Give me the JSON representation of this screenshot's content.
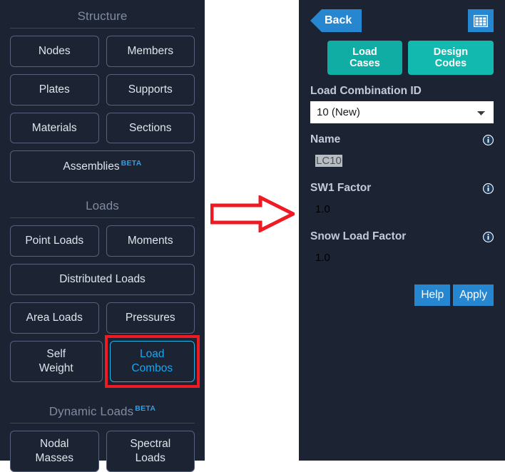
{
  "colors": {
    "panel_bg": "#1c2433",
    "accent_blue": "#2786d0",
    "accent_teal": "#0fada4",
    "active_cyan": "#16a7f0",
    "annotation_red": "#ee1b24",
    "beta_blue": "#2f9fe8"
  },
  "sidebar": {
    "sections": [
      {
        "title": "Structure",
        "rows": [
          [
            {
              "label": "Nodes"
            },
            {
              "label": "Members"
            }
          ],
          [
            {
              "label": "Plates"
            },
            {
              "label": "Supports"
            }
          ],
          [
            {
              "label": "Materials"
            },
            {
              "label": "Sections"
            }
          ],
          [
            {
              "label": "Assemblies",
              "badge": "BETA",
              "full": true
            }
          ]
        ]
      },
      {
        "title": "Loads",
        "rows": [
          [
            {
              "label": "Point Loads"
            },
            {
              "label": "Moments"
            }
          ],
          [
            {
              "label": "Distributed Loads",
              "full": true
            }
          ],
          [
            {
              "label": "Area Loads"
            },
            {
              "label": "Pressures"
            }
          ],
          [
            {
              "label": "Self\nWeight",
              "two_line": true
            },
            {
              "label": "Load\nCombos",
              "two_line": true,
              "active": true,
              "highlighted": true
            }
          ]
        ]
      },
      {
        "title": "Dynamic Loads",
        "badge": "BETA",
        "rows": [
          [
            {
              "label": "Nodal\nMasses",
              "two_line": true
            },
            {
              "label": "Spectral\nLoads",
              "two_line": true
            }
          ]
        ]
      }
    ]
  },
  "annotation": {
    "arrow_direction": "right",
    "arrow_color": "#ee1b24",
    "highlight_target": "Load Combos"
  },
  "panel": {
    "back_label": "Back",
    "grid_icon": "table-grid-icon",
    "tabs": [
      {
        "label": "Load Cases"
      },
      {
        "label": "Design Codes"
      }
    ],
    "fields": [
      {
        "label": "Load Combination ID",
        "type": "select",
        "value": "10 (New)",
        "options": [
          "10 (New)"
        ],
        "info": false
      },
      {
        "label": "Name",
        "type": "text",
        "value": "LC10",
        "selected": true,
        "focused": true,
        "info": true
      },
      {
        "label": "SW1 Factor",
        "type": "text",
        "value": "1.0",
        "info": true
      },
      {
        "label": "Snow Load Factor",
        "type": "text",
        "value": "1.0",
        "info": true
      }
    ],
    "actions": [
      {
        "label": "Help"
      },
      {
        "label": "Apply"
      }
    ]
  }
}
